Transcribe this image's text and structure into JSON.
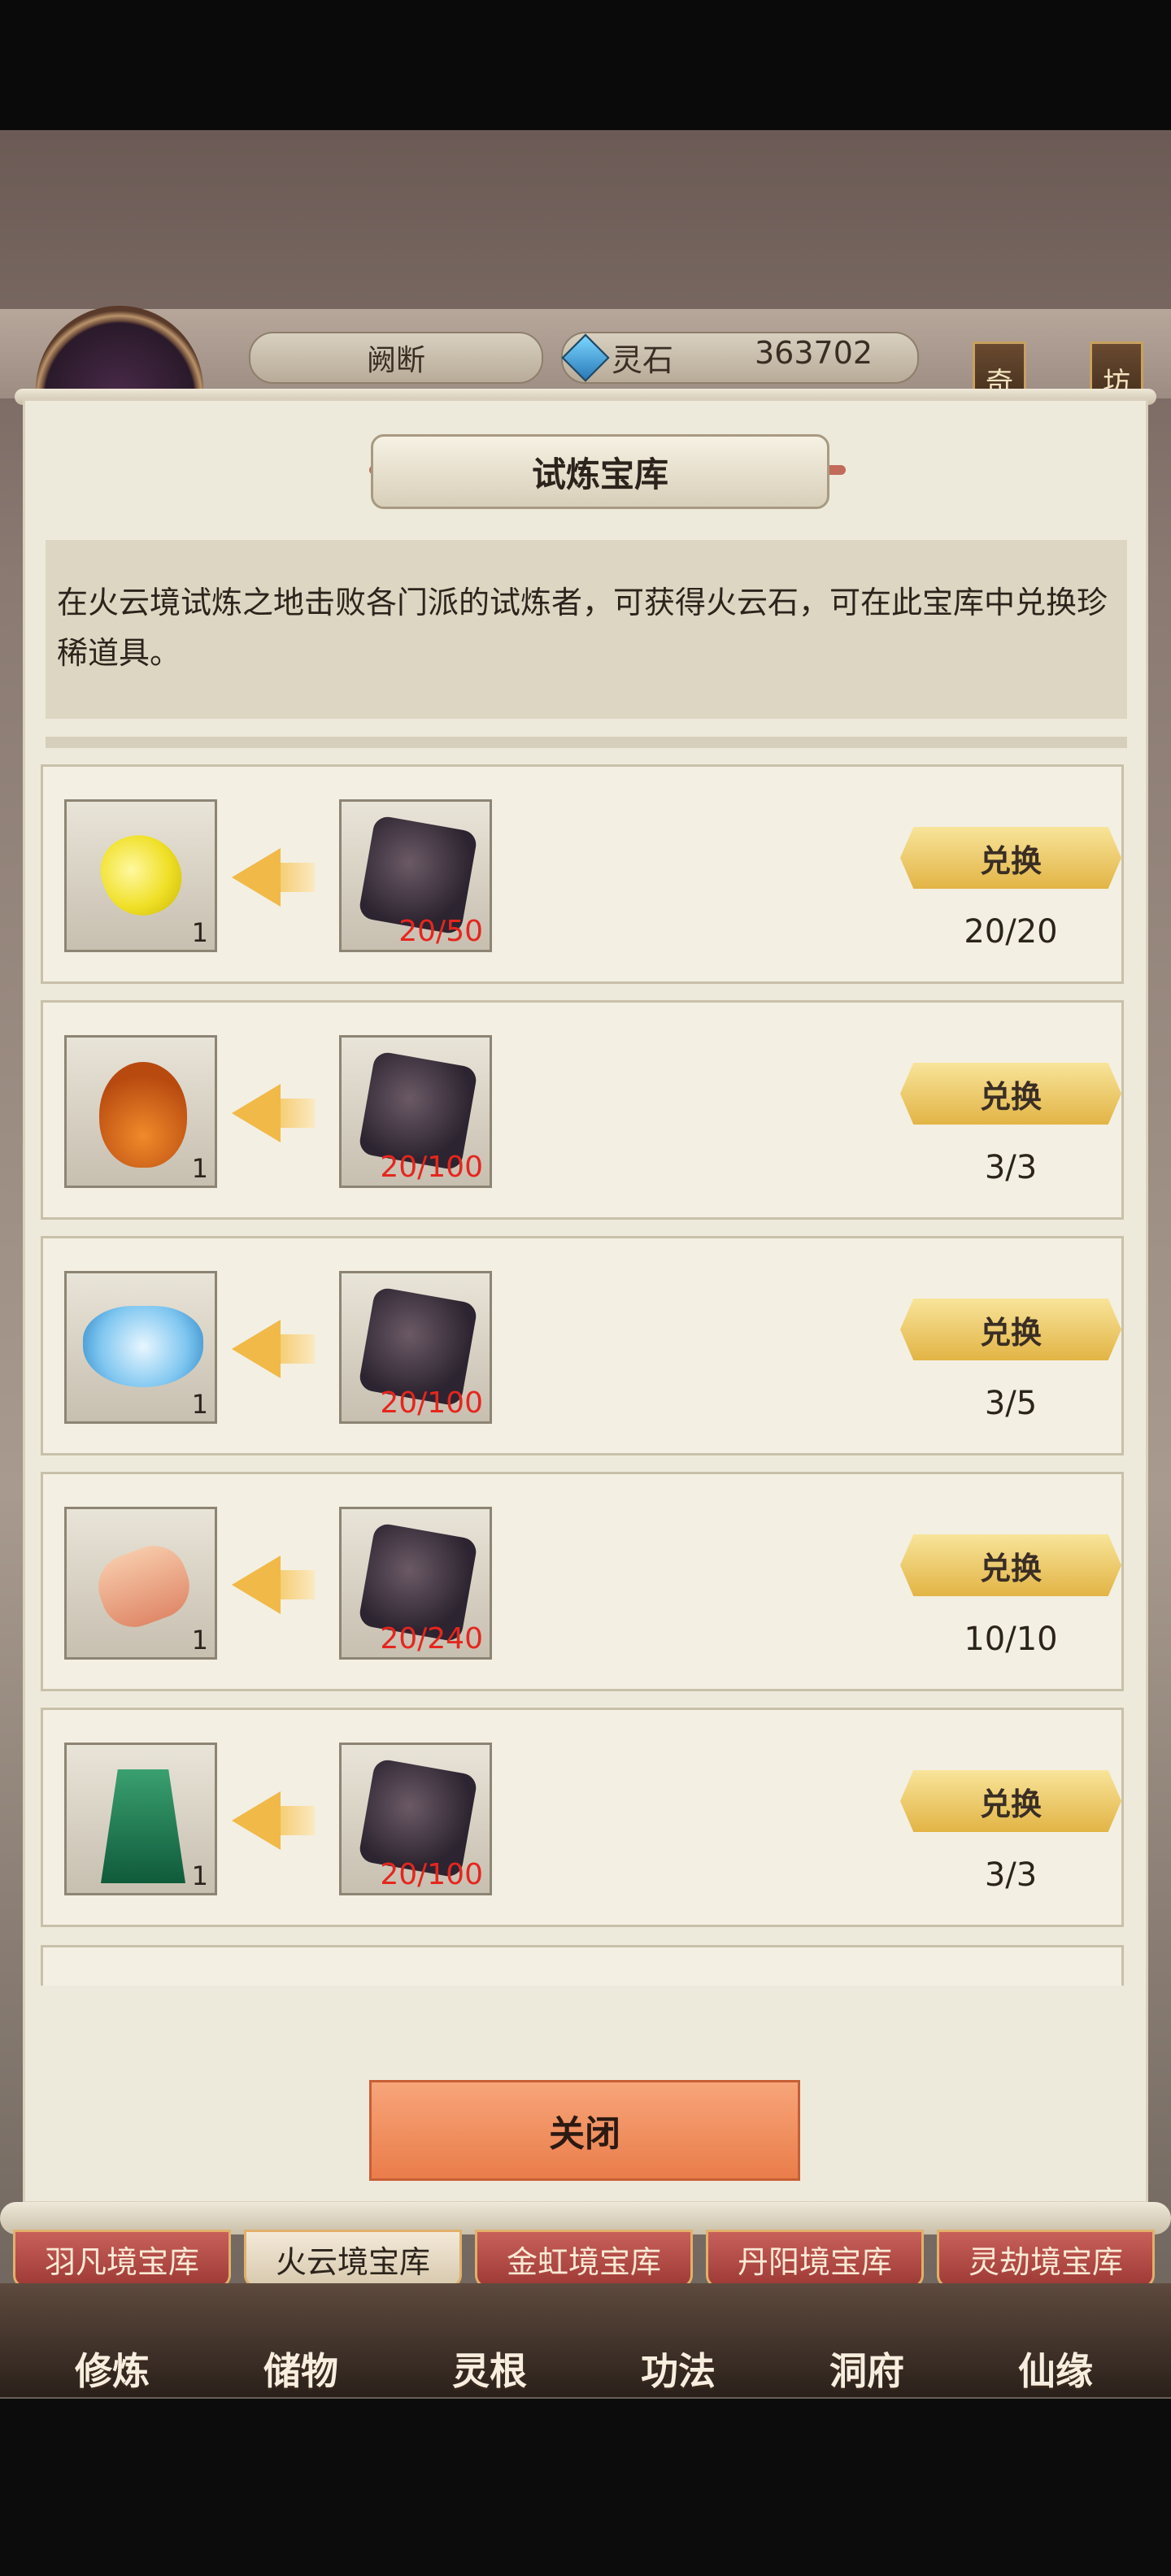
{
  "hud": {
    "player_name": "阙断",
    "currency_label": "灵石",
    "currency_value": "363702",
    "side_buttons": [
      "奇",
      "坊"
    ]
  },
  "panel": {
    "title": "试炼宝库",
    "description": "在火云境试炼之地击败各门派的试炼者，可获得火云石，可在此宝库中兑换珍稀道具。",
    "close_label": "关闭"
  },
  "exchange_rows": [
    {
      "item_icon": "yellow-gem-icon",
      "item_count": "1",
      "cost": "20/50",
      "button": "兑换",
      "limit": "20/20"
    },
    {
      "item_icon": "gourd-icon",
      "item_count": "1",
      "cost": "20/100",
      "button": "兑换",
      "limit": "3/3"
    },
    {
      "item_icon": "spirit-bowl-icon",
      "item_count": "1",
      "cost": "20/100",
      "button": "兑换",
      "limit": "3/5"
    },
    {
      "item_icon": "scroll-icon",
      "item_count": "1",
      "cost": "20/240",
      "button": "兑换",
      "limit": "10/10"
    },
    {
      "item_icon": "robe-icon",
      "item_count": "1",
      "cost": "20/100",
      "button": "兑换",
      "limit": "3/3"
    }
  ],
  "cost_icon": "fire-cloud-stone-icon",
  "tabs": [
    {
      "label": "羽凡境宝库",
      "active": false
    },
    {
      "label": "火云境宝库",
      "active": true
    },
    {
      "label": "金虹境宝库",
      "active": false
    },
    {
      "label": "丹阳境宝库",
      "active": false
    },
    {
      "label": "灵劫境宝库",
      "active": false
    }
  ],
  "bottom_nav": [
    "修炼",
    "储物",
    "灵根",
    "功法",
    "洞府",
    "仙缘"
  ]
}
